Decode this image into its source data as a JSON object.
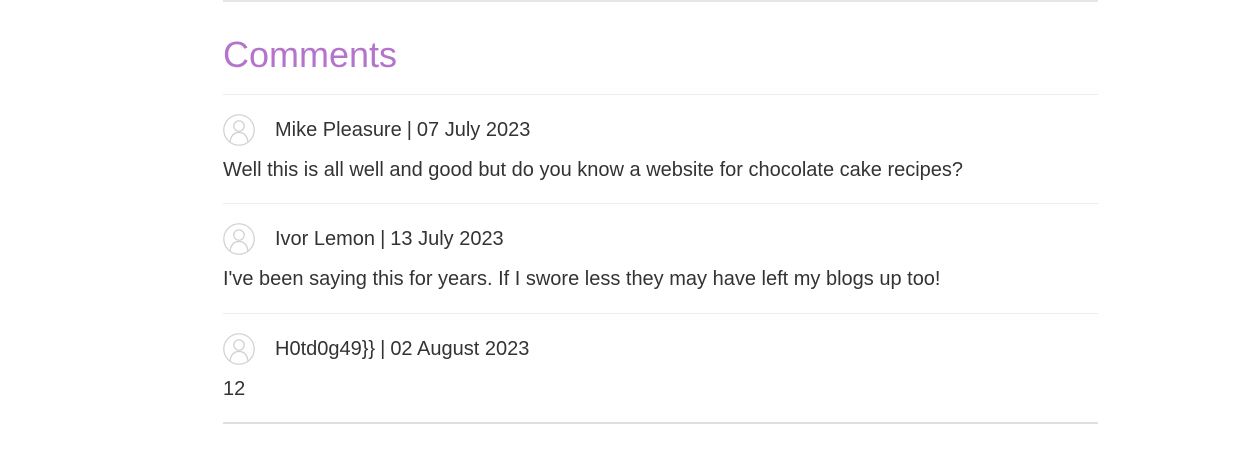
{
  "section": {
    "title": "Comments"
  },
  "comments": [
    {
      "author": "Mike Pleasure",
      "separator": "|",
      "date": "07 July 2023",
      "text": "Well this is all well and good but do you know a website for chocolate cake recipes?",
      "avatar_icon": "user-avatar-icon"
    },
    {
      "author": "Ivor Lemon",
      "separator": "|",
      "date": "13 July 2023",
      "text": "I've been saying this for years. If I swore less they may have left my blogs up too!",
      "avatar_icon": "user-avatar-icon"
    },
    {
      "author": "H0td0g49}}",
      "separator": "|",
      "date": "02 August 2023",
      "text": "12",
      "avatar_icon": "user-avatar-icon"
    }
  ],
  "colors": {
    "heading": "#b574cc",
    "text": "#333333",
    "divider": "#ececec"
  }
}
